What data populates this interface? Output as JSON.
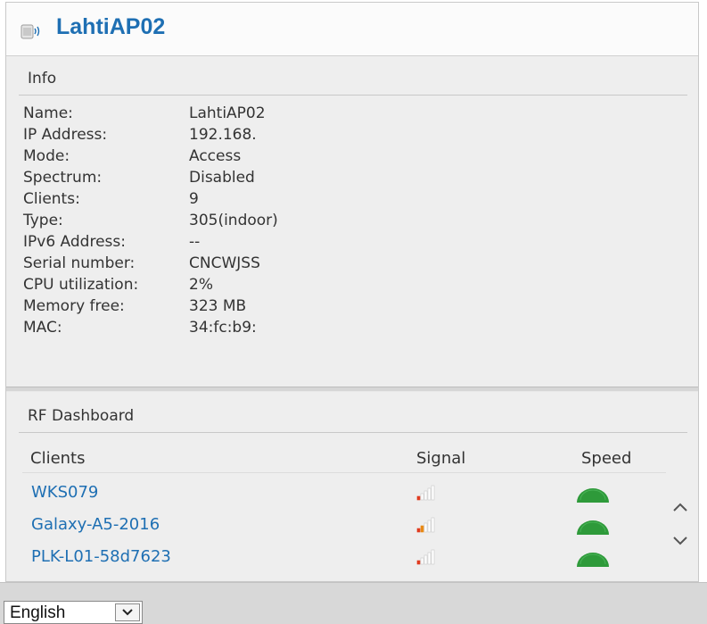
{
  "header": {
    "title": "LahtiAP02",
    "icon": "access-point-icon"
  },
  "info": {
    "heading": "Info",
    "rows": [
      {
        "label": "Name:",
        "value": "LahtiAP02"
      },
      {
        "label": "IP Address:",
        "value": "192.168."
      },
      {
        "label": "Mode:",
        "value": "Access"
      },
      {
        "label": "Spectrum:",
        "value": "Disabled"
      },
      {
        "label": "Clients:",
        "value": "9"
      },
      {
        "label": "Type:",
        "value": "305(indoor)"
      },
      {
        "label": "IPv6 Address:",
        "value": "--"
      },
      {
        "label": "Serial number:",
        "value": "CNCWJSS"
      },
      {
        "label": "CPU utilization:",
        "value": "2%"
      },
      {
        "label": "Memory free:",
        "value": "323 MB"
      },
      {
        "label": "MAC:",
        "value": "34:fc:b9:"
      }
    ]
  },
  "rf_dashboard": {
    "heading": "RF Dashboard",
    "columns": {
      "clients": "Clients",
      "signal": "Signal",
      "speed": "Speed"
    },
    "clients": [
      {
        "name": "WKS079",
        "signal_icon": "signal-weak-icon",
        "speed_icon": "speed-gauge-icon"
      },
      {
        "name": "Galaxy-A5-2016",
        "signal_icon": "signal-medium-icon",
        "speed_icon": "speed-gauge-icon"
      },
      {
        "name": "PLK-L01-58d7623",
        "signal_icon": "signal-weak-icon",
        "speed_icon": "speed-gauge-icon"
      }
    ]
  },
  "footer": {
    "language": "English"
  },
  "colors": {
    "link": "#1e6fb3",
    "gauge": "#2e9a3a",
    "signal_low": "#e03a1f",
    "signal_mid": "#e88a16"
  }
}
